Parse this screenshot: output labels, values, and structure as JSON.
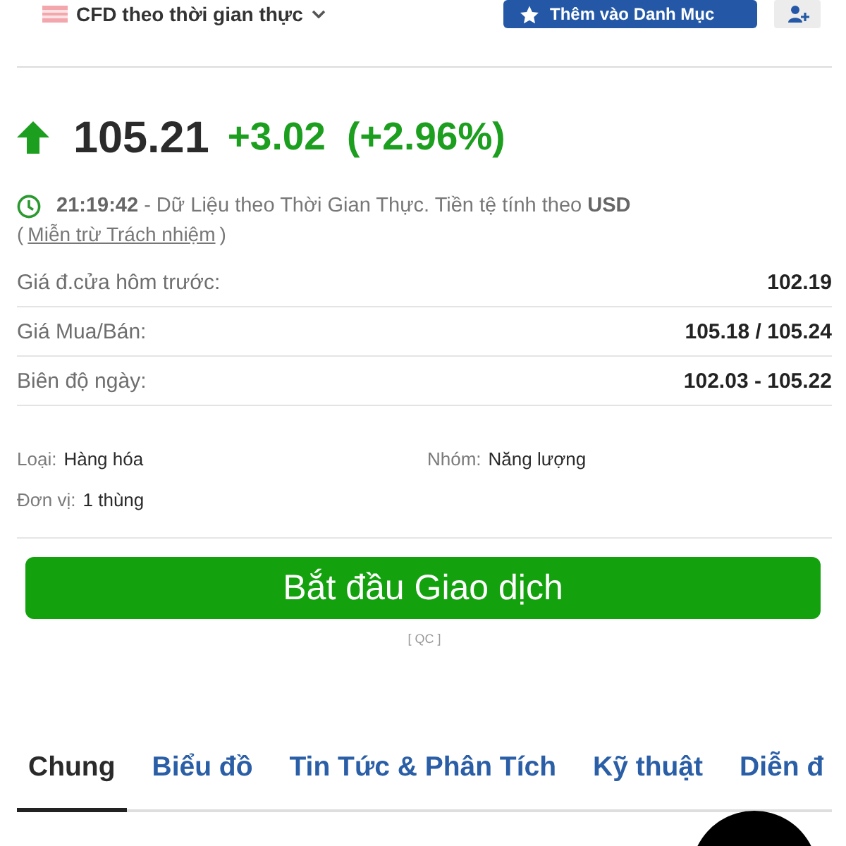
{
  "header": {
    "instrument": "CFD theo thời gian thực",
    "watchlist_button": "Thêm vào Danh Mục"
  },
  "quote": {
    "rising": true,
    "price": "105.21",
    "change": "+3.02",
    "change_percent": "(+2.96%)"
  },
  "status": {
    "text": "**21:19:42** - Dữ Liệu theo Thời Gian Thực. Tiền tệ tính theo **USD**",
    "disclaimer_open": "(",
    "disclaimer_link": "Miễn trừ Trách nhiệm",
    "disclaimer_close": ")"
  },
  "stats": [
    {
      "label": "Giá đ.cửa hôm trước:",
      "value": "102.19"
    },
    {
      "label": "Giá Mua/Bán:",
      "value": "105.18 / 105.24"
    },
    {
      "label": "Biên độ ngày:",
      "value": "102.03 - 105.22"
    }
  ],
  "details": [
    {
      "label": "Loại:",
      "value": "Hàng hóa"
    },
    {
      "label": "Nhóm:",
      "value": "Năng lượng"
    },
    {
      "label": "Đơn vị:",
      "value": "1 thùng"
    }
  ],
  "cta": {
    "label": "Bắt đầu Giao dịch",
    "ad_label": "[ QC ]"
  },
  "tabs": [
    {
      "label": "Chung",
      "selected": true
    },
    {
      "label": "Biểu đồ",
      "selected": false
    },
    {
      "label": "Tin Tức & Phân Tích",
      "selected": false
    },
    {
      "label": "Kỹ thuật",
      "selected": false
    },
    {
      "label": "Diễn đ",
      "selected": false
    }
  ]
}
